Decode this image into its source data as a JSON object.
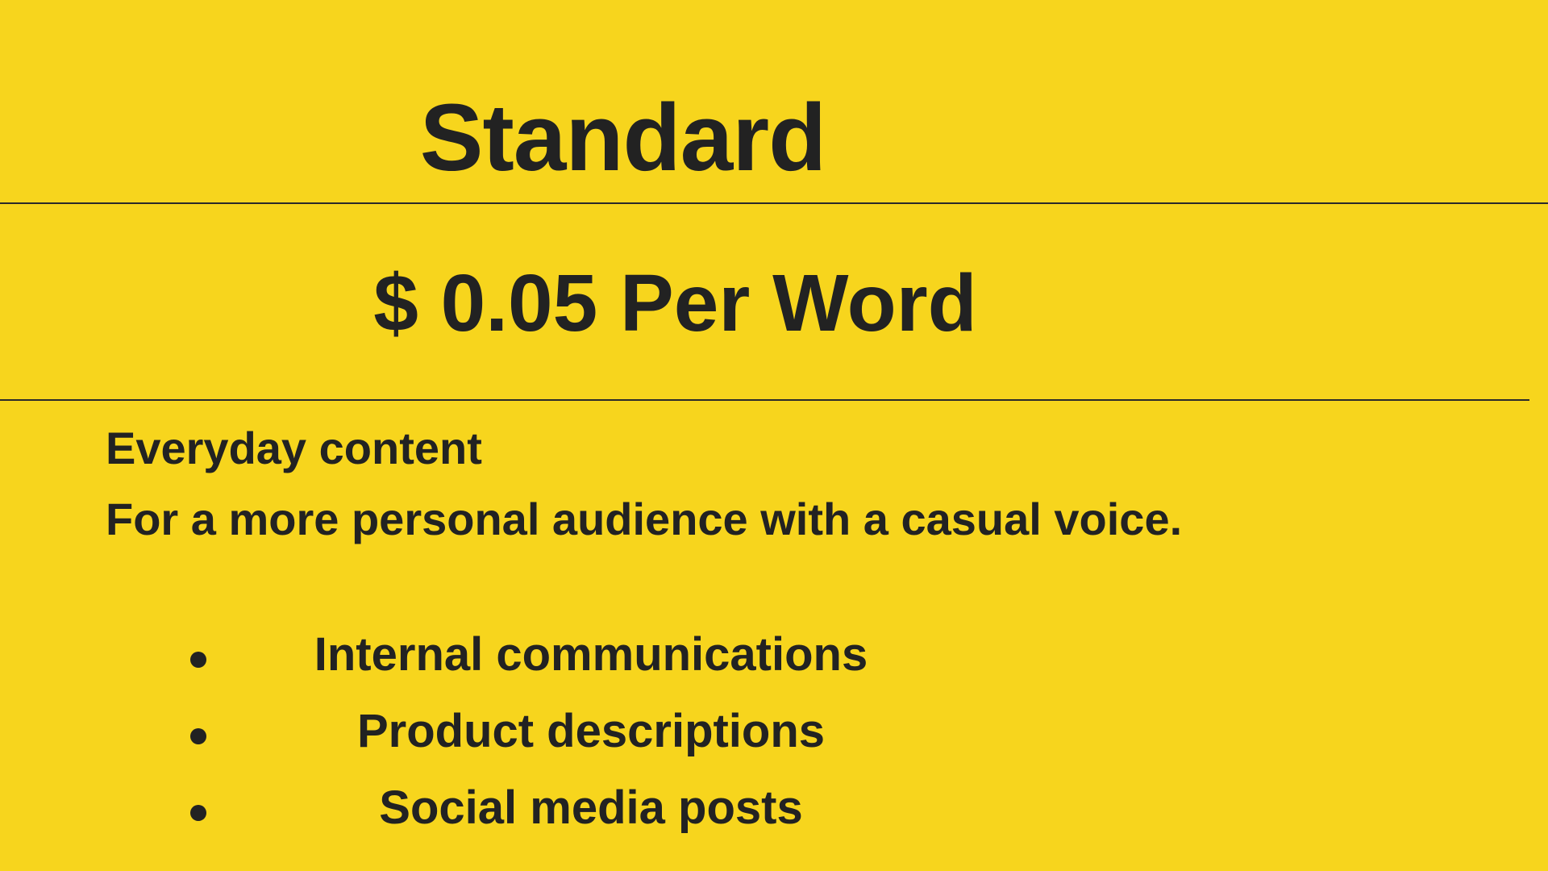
{
  "card": {
    "title": "Standard",
    "price": "$ 0.05 Per Word",
    "tagline": "Everyday content",
    "description": "For a more personal audience with a casual voice.",
    "features": [
      "Internal communications",
      "Product descriptions",
      "Social media posts"
    ]
  },
  "colors": {
    "background": "#F7D51D",
    "text": "#222222"
  }
}
